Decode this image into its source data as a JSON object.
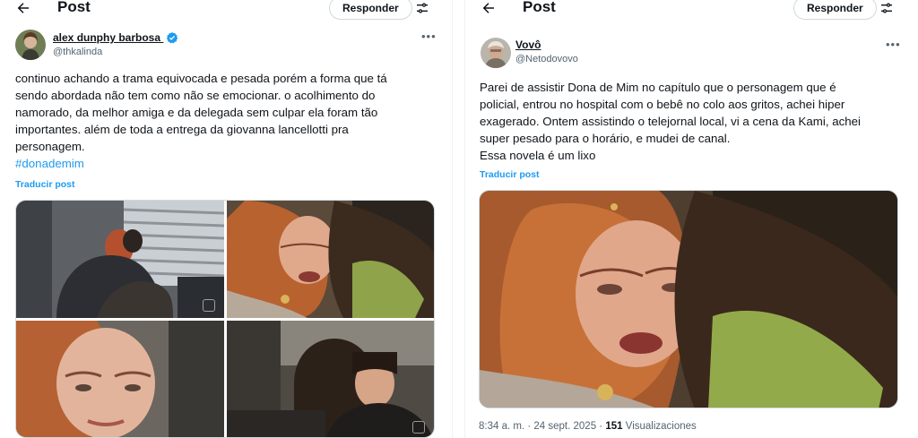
{
  "left": {
    "header": {
      "back_icon": "arrow-left-icon",
      "title": "Post",
      "reply_label": "Responder",
      "tune_icon": "sliders-icon"
    },
    "post": {
      "author_name": "alex dunphy barbosa",
      "verified": true,
      "handle": "@thkalinda",
      "more_icon": "more-horizontal-icon",
      "text_lines": [
        "continuo achando a trama equivocada e pesada porém a forma que tá",
        "sendo abordada não tem como não se emocionar. o acolhimento do",
        "namorado, da melhor amiga e da delegada sem culpar ela foram tão",
        "importantes. além de toda a entrega da giovanna lancellotti pra",
        "personagem."
      ],
      "hashtag": "#donademim",
      "translate": "Traducir post",
      "images": [
        "office-hug-scene",
        "crying-embrace-scene",
        "tearful-closeup-scene",
        "woman-in-car-scene"
      ]
    }
  },
  "right": {
    "header": {
      "back_icon": "arrow-left-icon",
      "title": "Post",
      "reply_label": "Responder",
      "tune_icon": "sliders-icon"
    },
    "post": {
      "author_name": "Vovô",
      "handle": "@Netodovovo",
      "more_icon": "more-horizontal-icon",
      "text_lines": [
        "Parei de assistir Dona de Mim no capítulo que o personagem que é",
        "policial, entrou no hospital com o bebê no colo aos gritos, achei hiper",
        "exagerado. Ontem assistindo o telejornal local, vi a cena da Kami, achei",
        "super pesado para o horário, e mudei de canal.",
        "Essa novela é um lixo"
      ],
      "translate": "Traducir post",
      "image": "crying-embrace-scene",
      "time": "8:34 a. m.",
      "separator": "·",
      "date": "24 sept. 2025",
      "views_count": "151",
      "views_label": "Visualizaciones"
    }
  },
  "colors": {
    "link": "#1d9bf0",
    "verified": "#1d9bf0",
    "muted": "#536471",
    "border": "#cfd9de"
  }
}
